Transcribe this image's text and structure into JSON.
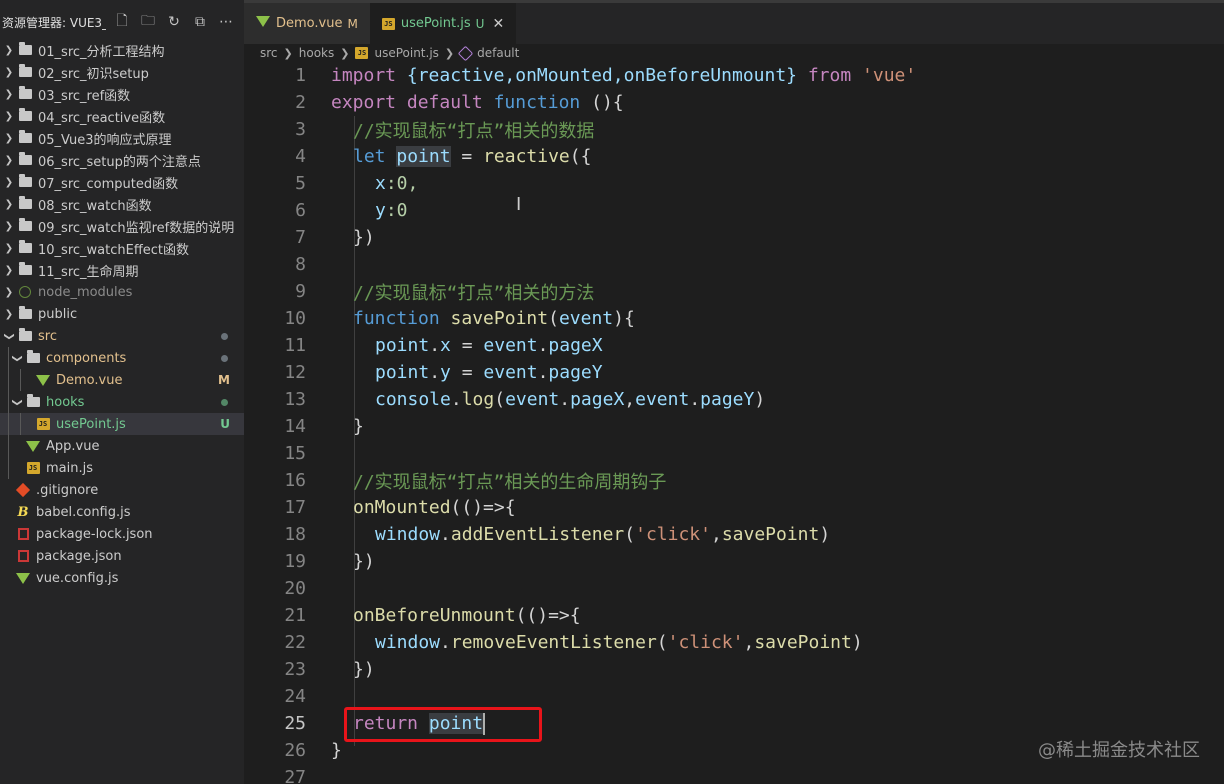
{
  "explorer": {
    "title": "资源管理器: VUE3_...",
    "items": [
      {
        "label": "01_src_分析工程结构",
        "type": "folder"
      },
      {
        "label": "02_src_初识setup",
        "type": "folder"
      },
      {
        "label": "03_src_ref函数",
        "type": "folder"
      },
      {
        "label": "04_src_reactive函数",
        "type": "folder"
      },
      {
        "label": "05_Vue3的响应式原理",
        "type": "folder"
      },
      {
        "label": "06_src_setup的两个注意点",
        "type": "folder"
      },
      {
        "label": "07_src_computed函数",
        "type": "folder"
      },
      {
        "label": "08_src_watch函数",
        "type": "folder"
      },
      {
        "label": "09_src_watch监视ref数据的说明",
        "type": "folder"
      },
      {
        "label": "10_src_watchEffect函数",
        "type": "folder"
      },
      {
        "label": "11_src_生命周期",
        "type": "folder"
      },
      {
        "label": "node_modules",
        "type": "folder-dim"
      },
      {
        "label": "public",
        "type": "folder"
      },
      {
        "label": "src",
        "type": "folder-open"
      },
      {
        "label": "components",
        "type": "folder-open"
      },
      {
        "label": "Demo.vue",
        "type": "vue",
        "badge": "M"
      },
      {
        "label": "hooks",
        "type": "folder-open"
      },
      {
        "label": "usePoint.js",
        "type": "js",
        "badge": "U"
      },
      {
        "label": "App.vue",
        "type": "vue"
      },
      {
        "label": "main.js",
        "type": "js"
      },
      {
        "label": ".gitignore",
        "type": "git"
      },
      {
        "label": "babel.config.js",
        "type": "babel"
      },
      {
        "label": "package-lock.json",
        "type": "json"
      },
      {
        "label": "package.json",
        "type": "json"
      },
      {
        "label": "vue.config.js",
        "type": "vue"
      }
    ]
  },
  "tabs": [
    {
      "label": "Demo.vue",
      "flag": "M",
      "icon": "vue-icon"
    },
    {
      "label": "usePoint.js",
      "flag": "U",
      "icon": "js-icon",
      "close": "✕"
    }
  ],
  "breadcrumb": {
    "parts": [
      "src",
      "hooks",
      "usePoint.js",
      "default"
    ]
  },
  "editor": {
    "current_line": 25,
    "line_numbers": [
      "1",
      "2",
      "3",
      "4",
      "5",
      "6",
      "7",
      "8",
      "9",
      "10",
      "11",
      "12",
      "13",
      "14",
      "15",
      "16",
      "17",
      "18",
      "19",
      "20",
      "21",
      "22",
      "23",
      "24",
      "25",
      "26",
      "27"
    ],
    "code": {
      "l1_import": "import",
      "l1_body": " {reactive,onMounted,onBeforeUnmount} ",
      "l1_from": "from",
      "l1_str": "'vue'",
      "l2_export": "export",
      "l2_default": "default",
      "l2_function": "function",
      "l2_rest": " (){",
      "l3": "//实现鼠标“打点”相关的数据",
      "l4_let": "let",
      "l4_point": "point",
      "l4_eq": " = ",
      "l4_fn": "reactive",
      "l4_rest": "({",
      "l5_key": "x",
      "l5_rest": ":0,",
      "l6_key": "y",
      "l6_rest": ":0",
      "l7": "})",
      "l9": "//实现鼠标“打点”相关的方法",
      "l10_function": "function",
      "l10_name": "savePoint",
      "l10_param": "event",
      "l10_open": "(",
      "l10_close": "){",
      "l11_obj": "point",
      "l11_prop": "x",
      "l11_eq": " = ",
      "l11_ev": "event",
      "l11_evprop": "pageX",
      "l12_obj": "point",
      "l12_prop": "y",
      "l12_eq": " = ",
      "l12_ev": "event",
      "l12_evprop": "pageY",
      "l13_console": "console",
      "l13_log": "log",
      "l13_ev1": "event",
      "l13_p1": "pageX",
      "l13_ev2": "event",
      "l13_p2": "pageY",
      "l14": "}",
      "l16": "//实现鼠标“打点”相关的生命周期钩子",
      "l17_fn": "onMounted",
      "l17_rest": "(()=>{",
      "l18_win": "window",
      "l18_method": "addEventListener",
      "l18_str": "'click'",
      "l18_arg": "savePoint",
      "l19": "})",
      "l21_fn": "onBeforeUnmount",
      "l21_rest": "(()=>{",
      "l22_win": "window",
      "l22_method": "removeEventListener",
      "l22_str": "'click'",
      "l22_arg": "savePoint",
      "l23": "})",
      "l25_return": "return",
      "l25_point": "point",
      "l26": "}"
    }
  },
  "cursor_glyph": "I",
  "watermark": "@稀土掘金技术社区",
  "colors": {
    "highlight_box": "#e8141a",
    "editor_bg": "#1e1e1e",
    "sidebar_bg": "#252526"
  }
}
